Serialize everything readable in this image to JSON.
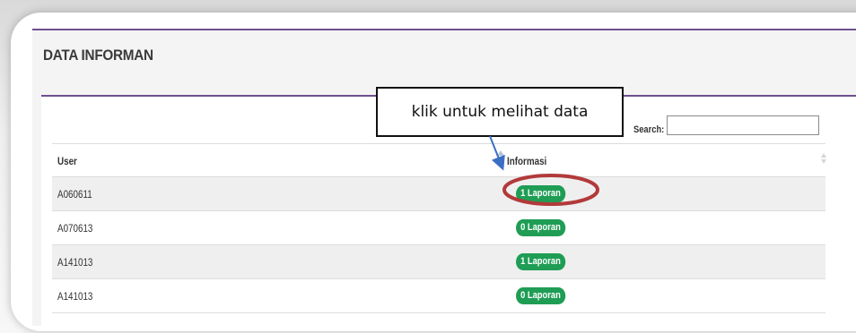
{
  "page": {
    "title": "DATA INFORMAN"
  },
  "search": {
    "label": "Search:",
    "value": ""
  },
  "table": {
    "columns": [
      "User",
      "Informasi"
    ],
    "rows": [
      {
        "user": "A060611",
        "info": "1 Laporan"
      },
      {
        "user": "A070613",
        "info": "0 Laporan"
      },
      {
        "user": "A141013",
        "info": "1 Laporan"
      },
      {
        "user": "A141013",
        "info": "0 Laporan"
      }
    ]
  },
  "annotation": {
    "callout_text": "klik untuk melihat data",
    "highlight_color": "#b23a3a",
    "arrow_color": "#3b6fc4"
  },
  "colors": {
    "accent": "#6e4f8f",
    "badge": "#1f9d55"
  }
}
